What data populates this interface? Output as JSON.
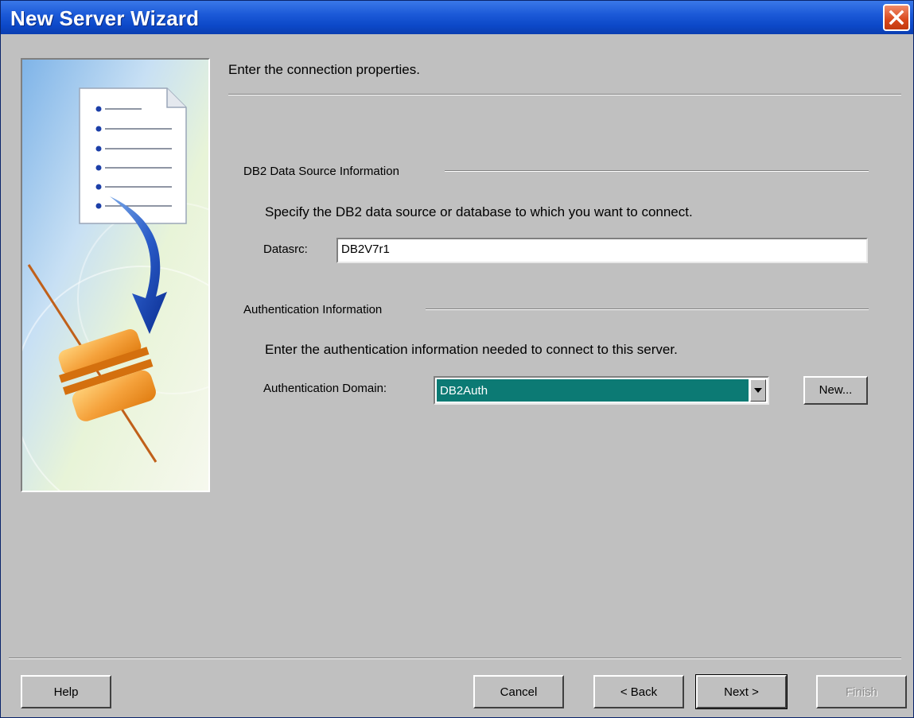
{
  "window": {
    "title": "New Server Wizard"
  },
  "page": {
    "heading": "Enter the connection properties.",
    "datasource": {
      "group_label": "DB2 Data Source Information",
      "description": "Specify the DB2 data source or database to which you want to connect.",
      "field_label": "Datasrc:",
      "field_value": "DB2V7r1"
    },
    "authentication": {
      "group_label": "Authentication Information",
      "description": "Enter the authentication information needed to connect to this server.",
      "domain_label": "Authentication Domain:",
      "domain_value": "DB2Auth",
      "new_button": "New..."
    }
  },
  "buttons": {
    "help": "Help",
    "cancel": "Cancel",
    "back": "< Back",
    "next": "Next >",
    "finish": "Finish"
  },
  "colors": {
    "title_bar": "#0c48c8",
    "dialog_bg": "#c0c0c0",
    "selection": "#0c7a74",
    "close_button": "#d9481c"
  },
  "icons": [
    "close-icon",
    "wizard-illustration",
    "dropdown-arrow-icon"
  ]
}
